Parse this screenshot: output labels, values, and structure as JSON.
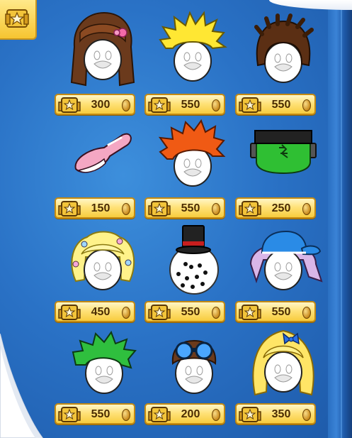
{
  "catalog": {
    "colors": {
      "page": "#2a72c6",
      "tag": "#ffe27a",
      "tag_border": "#c48a12",
      "price_text": "#4a2c02"
    },
    "badge_icon": "star-icon",
    "items": [
      {
        "icon": "brown-long-hair-with-pink-bow",
        "price": "300"
      },
      {
        "icon": "yellow-spiky-hair",
        "price": "550"
      },
      {
        "icon": "brown-dreadlocks",
        "price": "550"
      },
      {
        "icon": "pink-bunny-ears",
        "price": "150"
      },
      {
        "icon": "orange-spiky-hair",
        "price": "550"
      },
      {
        "icon": "frankenstein-head",
        "price": "250"
      },
      {
        "icon": "blonde-curls-with-flowers",
        "price": "450"
      },
      {
        "icon": "snowman-head-with-top-hat",
        "price": "550"
      },
      {
        "icon": "blue-cap-with-lilac-hair",
        "price": "550"
      },
      {
        "icon": "green-spiky-hair",
        "price": "550"
      },
      {
        "icon": "aviator-goggles-cap",
        "price": "200"
      },
      {
        "icon": "long-blonde-hair-with-blue-bow",
        "price": "350"
      }
    ]
  }
}
